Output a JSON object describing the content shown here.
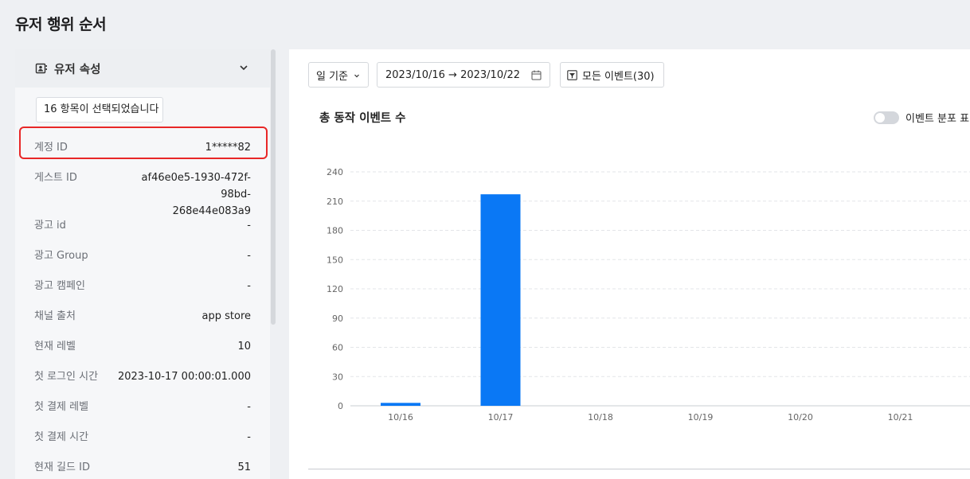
{
  "page": {
    "title": "유저 행위 순서"
  },
  "left_panel": {
    "header": {
      "title": "유저 속성",
      "icon": "contact-card-icon",
      "toggle_icon": "chevron-down-icon"
    },
    "selection_text": "16 항목이 선택되었습니다",
    "attributes": [
      {
        "key": "계정 ID",
        "value": "1*****82"
      },
      {
        "key": "게스트 ID",
        "value": "af46e0e5-1930-472f-98bd-\n268e44e083a9"
      },
      {
        "key": "광고 id",
        "value": "-"
      },
      {
        "key": "광고 Group",
        "value": "-"
      },
      {
        "key": "광고 캠페인",
        "value": "-"
      },
      {
        "key": "채널 출처",
        "value": "app store"
      },
      {
        "key": "현재 레벨",
        "value": "10"
      },
      {
        "key": "첫 로그인 시간",
        "value": "2023-10-17 00:00:01.000"
      },
      {
        "key": "첫 결제 레벨",
        "value": "-"
      },
      {
        "key": "첫 결제 시간",
        "value": "-"
      },
      {
        "key": "현재 길드 ID",
        "value": "51"
      }
    ],
    "highlight_color": "#e82727"
  },
  "controls": {
    "period": "일 기준",
    "date_range": "2023/10/16 → 2023/10/22",
    "event_filter": "모든 이벤트(30)"
  },
  "chart_title": "총 동작 이벤트 수",
  "toggle_label": "이벤트 분포 표",
  "chart_data": {
    "type": "bar",
    "categories": [
      "10/16",
      "10/17",
      "10/18",
      "10/19",
      "10/20",
      "10/21"
    ],
    "values": [
      3,
      217,
      0,
      0,
      0,
      0
    ],
    "ylim": [
      0,
      240
    ],
    "yticks": [
      0,
      30,
      60,
      90,
      120,
      150,
      180,
      210,
      240
    ],
    "grid": true,
    "bar_color": "#0a78f5"
  }
}
